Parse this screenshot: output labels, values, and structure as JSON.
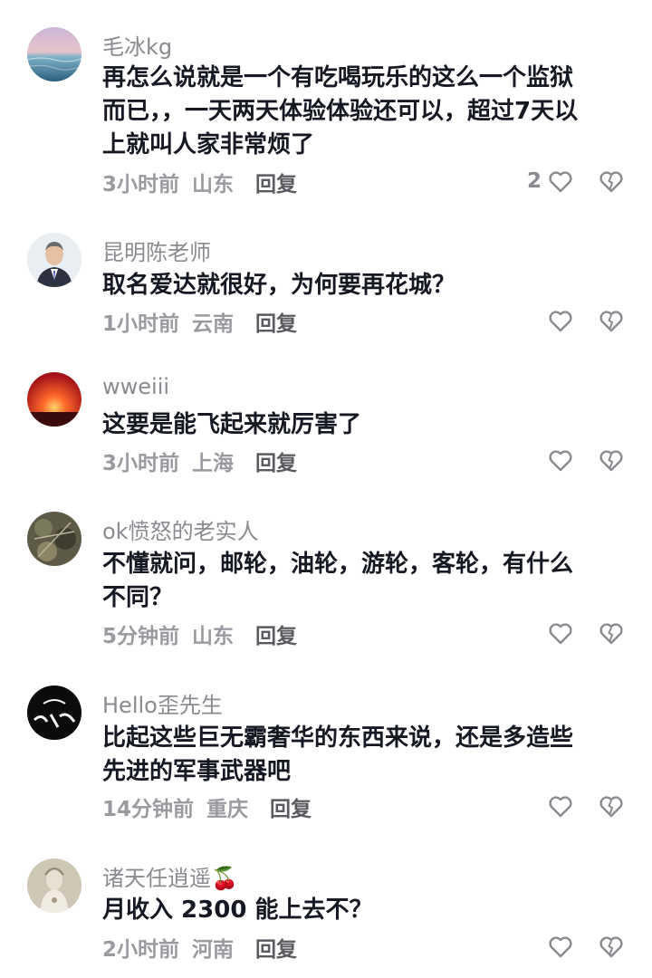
{
  "comments": [
    {
      "username": "毛冰kg",
      "text": "再怎么说就是一个有吃喝玩乐的这么一个监狱\n而已，，一天两天体验体验还可以，超过7天以\n上就叫人家非常烦了",
      "time": "3小时前",
      "location": "山东",
      "reply": "回复",
      "likes": "2",
      "avatar": "sea-sunset"
    },
    {
      "username": "昆明陈老师",
      "text": "取名爱达就很好，为何要再花城？",
      "time": "1小时前",
      "location": "云南",
      "reply": "回复",
      "likes": "",
      "avatar": "man-in-suit"
    },
    {
      "username": "wweiii",
      "text": "这要是能飞起来就厉害了",
      "time": "3小时前",
      "location": "上海",
      "reply": "回复",
      "likes": "",
      "avatar": "red-sunset"
    },
    {
      "username": "ok愤怒的老实人",
      "text": "不懂就问，邮轮，油轮，游轮，客轮，有什么\n不同？",
      "time": "5分钟前",
      "location": "山东",
      "reply": "回复",
      "likes": "",
      "avatar": "leaves"
    },
    {
      "username": "Hello歪先生",
      "text": "比起这些巨无霸奢华的东西来说，还是多造些\n先进的军事武器吧",
      "time": "14分钟前",
      "location": "重庆",
      "reply": "回复",
      "likes": "",
      "avatar": "black-calligraphy"
    },
    {
      "username": "诸天任逍遥🍒",
      "text": "月收入 2300 能上去不？",
      "time": "2小时前",
      "location": "河南",
      "reply": "回复",
      "likes": "",
      "avatar": "guanyin-statue"
    }
  ]
}
